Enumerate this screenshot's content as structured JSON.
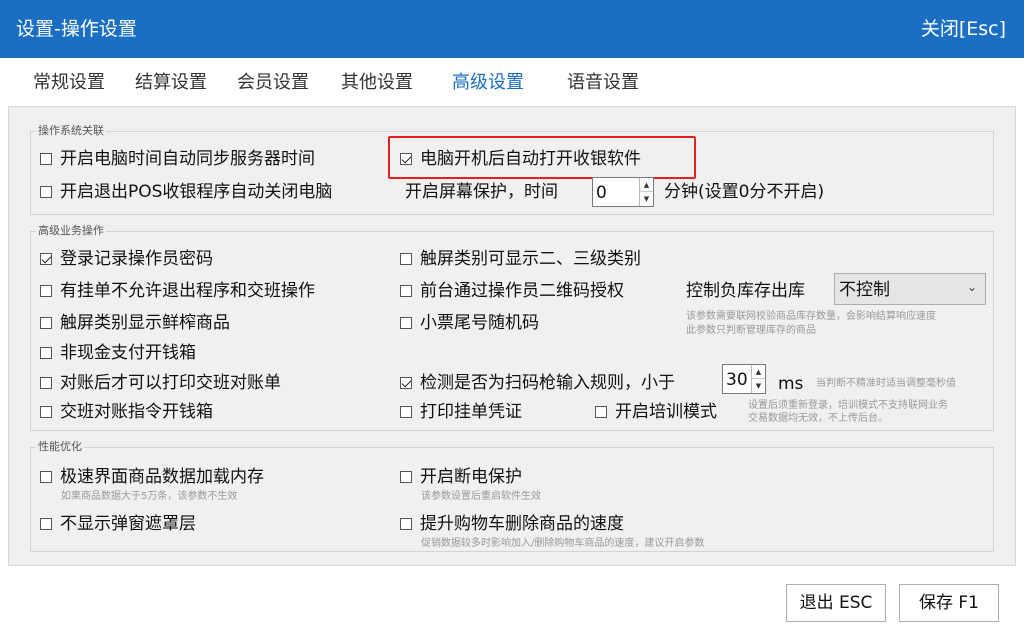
{
  "window": {
    "title": "设置-操作设置",
    "close_label": "关闭[Esc]"
  },
  "tabs": [
    {
      "label": "常规设置"
    },
    {
      "label": "结算设置"
    },
    {
      "label": "会员设置"
    },
    {
      "label": "其他设置"
    },
    {
      "label": "高级设置",
      "active": true
    },
    {
      "label": "语音设置"
    }
  ],
  "groups": {
    "os": {
      "label": "操作系统关联",
      "sync_time": {
        "label": "开启电脑时间自动同步服务器时间",
        "checked": false
      },
      "auto_start": {
        "label": "电脑开机后自动打开收银软件",
        "checked": true
      },
      "auto_shutdown": {
        "label": "开启退出POS收银程序自动关闭电脑",
        "checked": false
      },
      "screensaver": {
        "prefix": "开启屏幕保护，时间",
        "value": "0",
        "suffix": "分钟(设置0分不开启)"
      }
    },
    "business": {
      "label": "高级业务操作",
      "record_password": {
        "label": "登录记录操作员密码",
        "checked": true
      },
      "touch_subcategory": {
        "label": "触屏类别可显示二、三级类别",
        "checked": false
      },
      "suspend_no_exit": {
        "label": "有挂单不允许退出程序和交班操作",
        "checked": false
      },
      "qr_authorize": {
        "label": "前台通过操作员二维码授权",
        "checked": false
      },
      "negative_stock": {
        "label": "控制负库存出库",
        "value": "不控制",
        "hint1": "该参数需要联网校验商品库存数量，会影响结算响应速度",
        "hint2": "此参数只判断管理库存的商品"
      },
      "fresh_goods": {
        "label": "触屏类别显示鲜榨商品",
        "checked": false
      },
      "receipt_random": {
        "label": "小票尾号随机码",
        "checked": false
      },
      "noncash_drawer": {
        "label": "非现金支付开钱箱",
        "checked": false
      },
      "print_reconcile": {
        "label": "对账后才可以打印交班对账单",
        "checked": false
      },
      "scanner_rule": {
        "label": "检测是否为扫码枪输入规则，小于",
        "checked": true,
        "value": "30",
        "unit": "ms",
        "hint": "当判断不精准时适当调整毫秒值"
      },
      "handover_drawer": {
        "label": "交班对账指令开钱箱",
        "checked": false
      },
      "print_suspend": {
        "label": "打印挂单凭证",
        "checked": false
      },
      "training_mode": {
        "label": "开启培训模式",
        "checked": false,
        "hint1": "设置后须重新登录，培训模式不支持联网业务",
        "hint2": "交易数据均无效，不上传后台。"
      }
    },
    "performance": {
      "label": "性能优化",
      "fast_load": {
        "label": "极速界面商品数据加载内存",
        "checked": false,
        "hint": "如果商品数据大于5万条，该参数不生效"
      },
      "power_protect": {
        "label": "开启断电保护",
        "checked": false,
        "hint": "该参数设置后重启软件生效"
      },
      "no_mask": {
        "label": "不显示弹窗遮罩层",
        "checked": false
      },
      "fast_delete": {
        "label": "提升购物车删除商品的速度",
        "checked": false,
        "hint": "促销数据较多时影响加入/删除购物车商品的速度，建议开启参数"
      }
    }
  },
  "buttons": {
    "exit": "退出 ESC",
    "save": "保存 F1"
  },
  "colors": {
    "title_bar": "#1a6fc4",
    "active_tab": "#1a6fc4",
    "highlight": "#e0211f"
  }
}
